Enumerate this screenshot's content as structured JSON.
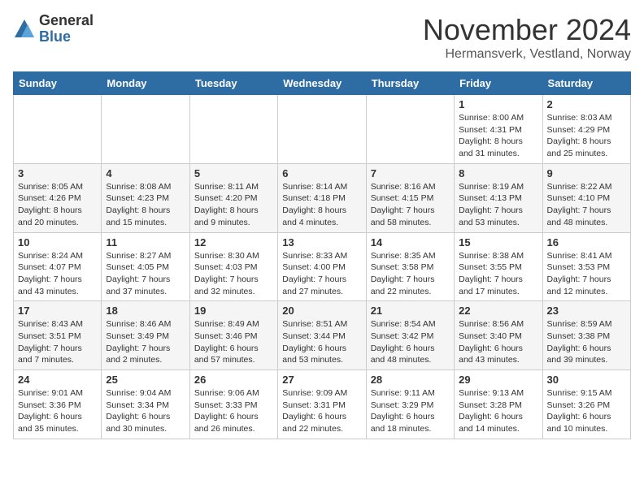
{
  "logo": {
    "general": "General",
    "blue": "Blue"
  },
  "header": {
    "month": "November 2024",
    "location": "Hermansverk, Vestland, Norway"
  },
  "weekdays": [
    "Sunday",
    "Monday",
    "Tuesday",
    "Wednesday",
    "Thursday",
    "Friday",
    "Saturday"
  ],
  "rows": [
    [
      {
        "day": "",
        "info": ""
      },
      {
        "day": "",
        "info": ""
      },
      {
        "day": "",
        "info": ""
      },
      {
        "day": "",
        "info": ""
      },
      {
        "day": "",
        "info": ""
      },
      {
        "day": "1",
        "info": "Sunrise: 8:00 AM\nSunset: 4:31 PM\nDaylight: 8 hours and 31 minutes."
      },
      {
        "day": "2",
        "info": "Sunrise: 8:03 AM\nSunset: 4:29 PM\nDaylight: 8 hours and 25 minutes."
      }
    ],
    [
      {
        "day": "3",
        "info": "Sunrise: 8:05 AM\nSunset: 4:26 PM\nDaylight: 8 hours and 20 minutes."
      },
      {
        "day": "4",
        "info": "Sunrise: 8:08 AM\nSunset: 4:23 PM\nDaylight: 8 hours and 15 minutes."
      },
      {
        "day": "5",
        "info": "Sunrise: 8:11 AM\nSunset: 4:20 PM\nDaylight: 8 hours and 9 minutes."
      },
      {
        "day": "6",
        "info": "Sunrise: 8:14 AM\nSunset: 4:18 PM\nDaylight: 8 hours and 4 minutes."
      },
      {
        "day": "7",
        "info": "Sunrise: 8:16 AM\nSunset: 4:15 PM\nDaylight: 7 hours and 58 minutes."
      },
      {
        "day": "8",
        "info": "Sunrise: 8:19 AM\nSunset: 4:13 PM\nDaylight: 7 hours and 53 minutes."
      },
      {
        "day": "9",
        "info": "Sunrise: 8:22 AM\nSunset: 4:10 PM\nDaylight: 7 hours and 48 minutes."
      }
    ],
    [
      {
        "day": "10",
        "info": "Sunrise: 8:24 AM\nSunset: 4:07 PM\nDaylight: 7 hours and 43 minutes."
      },
      {
        "day": "11",
        "info": "Sunrise: 8:27 AM\nSunset: 4:05 PM\nDaylight: 7 hours and 37 minutes."
      },
      {
        "day": "12",
        "info": "Sunrise: 8:30 AM\nSunset: 4:03 PM\nDaylight: 7 hours and 32 minutes."
      },
      {
        "day": "13",
        "info": "Sunrise: 8:33 AM\nSunset: 4:00 PM\nDaylight: 7 hours and 27 minutes."
      },
      {
        "day": "14",
        "info": "Sunrise: 8:35 AM\nSunset: 3:58 PM\nDaylight: 7 hours and 22 minutes."
      },
      {
        "day": "15",
        "info": "Sunrise: 8:38 AM\nSunset: 3:55 PM\nDaylight: 7 hours and 17 minutes."
      },
      {
        "day": "16",
        "info": "Sunrise: 8:41 AM\nSunset: 3:53 PM\nDaylight: 7 hours and 12 minutes."
      }
    ],
    [
      {
        "day": "17",
        "info": "Sunrise: 8:43 AM\nSunset: 3:51 PM\nDaylight: 7 hours and 7 minutes."
      },
      {
        "day": "18",
        "info": "Sunrise: 8:46 AM\nSunset: 3:49 PM\nDaylight: 7 hours and 2 minutes."
      },
      {
        "day": "19",
        "info": "Sunrise: 8:49 AM\nSunset: 3:46 PM\nDaylight: 6 hours and 57 minutes."
      },
      {
        "day": "20",
        "info": "Sunrise: 8:51 AM\nSunset: 3:44 PM\nDaylight: 6 hours and 53 minutes."
      },
      {
        "day": "21",
        "info": "Sunrise: 8:54 AM\nSunset: 3:42 PM\nDaylight: 6 hours and 48 minutes."
      },
      {
        "day": "22",
        "info": "Sunrise: 8:56 AM\nSunset: 3:40 PM\nDaylight: 6 hours and 43 minutes."
      },
      {
        "day": "23",
        "info": "Sunrise: 8:59 AM\nSunset: 3:38 PM\nDaylight: 6 hours and 39 minutes."
      }
    ],
    [
      {
        "day": "24",
        "info": "Sunrise: 9:01 AM\nSunset: 3:36 PM\nDaylight: 6 hours and 35 minutes."
      },
      {
        "day": "25",
        "info": "Sunrise: 9:04 AM\nSunset: 3:34 PM\nDaylight: 6 hours and 30 minutes."
      },
      {
        "day": "26",
        "info": "Sunrise: 9:06 AM\nSunset: 3:33 PM\nDaylight: 6 hours and 26 minutes."
      },
      {
        "day": "27",
        "info": "Sunrise: 9:09 AM\nSunset: 3:31 PM\nDaylight: 6 hours and 22 minutes."
      },
      {
        "day": "28",
        "info": "Sunrise: 9:11 AM\nSunset: 3:29 PM\nDaylight: 6 hours and 18 minutes."
      },
      {
        "day": "29",
        "info": "Sunrise: 9:13 AM\nSunset: 3:28 PM\nDaylight: 6 hours and 14 minutes."
      },
      {
        "day": "30",
        "info": "Sunrise: 9:15 AM\nSunset: 3:26 PM\nDaylight: 6 hours and 10 minutes."
      }
    ]
  ]
}
